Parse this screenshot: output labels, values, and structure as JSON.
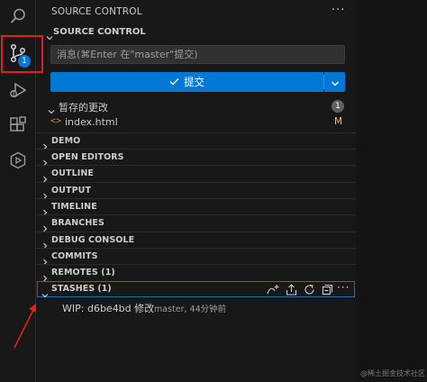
{
  "sidebar": {
    "title": "SOURCE CONTROL",
    "more": "···"
  },
  "activity_bar": {
    "scm_badge": "1"
  },
  "source_control": {
    "header": "SOURCE CONTROL",
    "commit_placeholder": "消息(⌘Enter 在\"master\"提交)",
    "commit_label": "提交",
    "staged_group": {
      "label": "暂存的更改",
      "count": "1"
    },
    "files": [
      {
        "name": "index.html",
        "status": "M",
        "icon": "<>"
      }
    ]
  },
  "panels": [
    "DEMO",
    "OPEN EDITORS",
    "OUTLINE",
    "OUTPUT",
    "TIMELINE",
    "BRANCHES",
    "DEBUG CONSOLE",
    "COMMITS",
    "REMOTES (1)"
  ],
  "stashes": {
    "label": "STASHES (1)",
    "more": "···",
    "items": [
      {
        "title": "WIP: d6be4bd 修改",
        "meta": "master, 44分钟前"
      }
    ]
  },
  "watermark": "@稀土掘金技术社区",
  "colors": {
    "accent": "#0078d4",
    "highlight": "#e0201f",
    "modified": "#e2c08d"
  }
}
